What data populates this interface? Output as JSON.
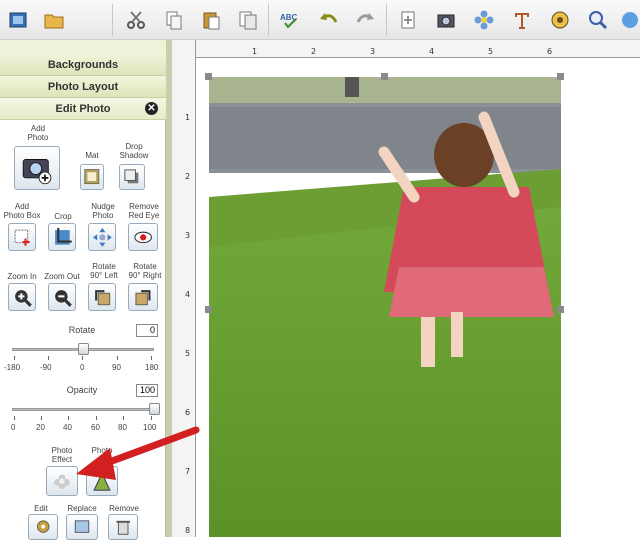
{
  "toolbar": {
    "icons": [
      "frame-icon",
      "folder-icon",
      "scissors-icon",
      "copy-icon",
      "paste-icon",
      "duplicate-icon",
      "spellcheck-icon",
      "undo-icon",
      "redo-icon",
      "new-page-icon",
      "camera-icon",
      "flower-icon",
      "text-icon",
      "film-icon",
      "zoom-icon",
      "help-icon"
    ],
    "spellcheck_text": "ABC"
  },
  "accordion": {
    "backgrounds": "Backgrounds",
    "photo_layout": "Photo Layout",
    "edit_photo": "Edit Photo",
    "close": "✕"
  },
  "edit_photo": {
    "add_photo": "Add\nPhoto",
    "mat": "Mat",
    "drop_shadow": "Drop\nShadow",
    "add_photo_box": "Add\nPhoto Box",
    "crop": "Crop",
    "nudge_photo": "Nudge\nPhoto",
    "remove_red_eye": "Remove\nRed Eye",
    "zoom_in": "Zoom In",
    "zoom_out": "Zoom Out",
    "rotate_left": "Rotate\n90° Left",
    "rotate_right": "Rotate\n90° Right",
    "rotate_label": "Rotate",
    "rotate_value": "0",
    "rotate_ticks": [
      "-180",
      "-90",
      "0",
      "90",
      "180"
    ],
    "rotate_level": 0.5,
    "opacity_label": "Opacity",
    "opacity_value": "100",
    "opacity_ticks": [
      "0",
      "20",
      "40",
      "60",
      "80",
      "100"
    ],
    "opacity_level": 1.0,
    "photo_effect": "Photo\nEffect",
    "photo_frame": "Photo",
    "edit": "Edit",
    "replace": "Replace",
    "remove": "Remove"
  },
  "ruler": {
    "h": [
      "1",
      "2",
      "3",
      "4",
      "5",
      "6"
    ],
    "v": [
      "1",
      "2",
      "3",
      "4",
      "5",
      "6",
      "7",
      "8"
    ]
  },
  "colors": {
    "accent": "#d21f1f",
    "panel_bg": "#eef2d8",
    "grass": "#6aa233"
  }
}
